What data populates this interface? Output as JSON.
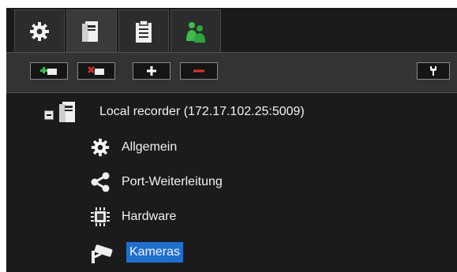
{
  "tabs": [
    {
      "id": "settings",
      "icon": "gear-icon"
    },
    {
      "id": "recorder",
      "icon": "server-icon"
    },
    {
      "id": "clipboard",
      "icon": "clipboard-icon"
    },
    {
      "id": "users",
      "icon": "users-icon"
    }
  ],
  "toolbar": {
    "buttons": [
      {
        "id": "add-recorder",
        "icon": "add-recorder-icon"
      },
      {
        "id": "remove-recorder",
        "icon": "remove-recorder-icon"
      },
      {
        "id": "add",
        "icon": "plus-icon"
      },
      {
        "id": "remove",
        "icon": "minus-icon"
      },
      {
        "id": "tools",
        "icon": "wrench-icon"
      }
    ]
  },
  "tree": {
    "root": {
      "label": "Local recorder (172.17.102.25:5009)"
    },
    "children": [
      {
        "label": "Allgemein",
        "icon": "gear-icon"
      },
      {
        "label": "Port-Weiterleitung",
        "icon": "share-icon"
      },
      {
        "label": "Hardware",
        "icon": "chip-icon"
      },
      {
        "label": "Kameras",
        "icon": "camera-icon",
        "selected": true
      }
    ]
  },
  "colors": {
    "background": "#1e1e1e",
    "selection": "#1f6fcf",
    "accent_green": "#38b54a",
    "accent_red": "#e0322b"
  }
}
